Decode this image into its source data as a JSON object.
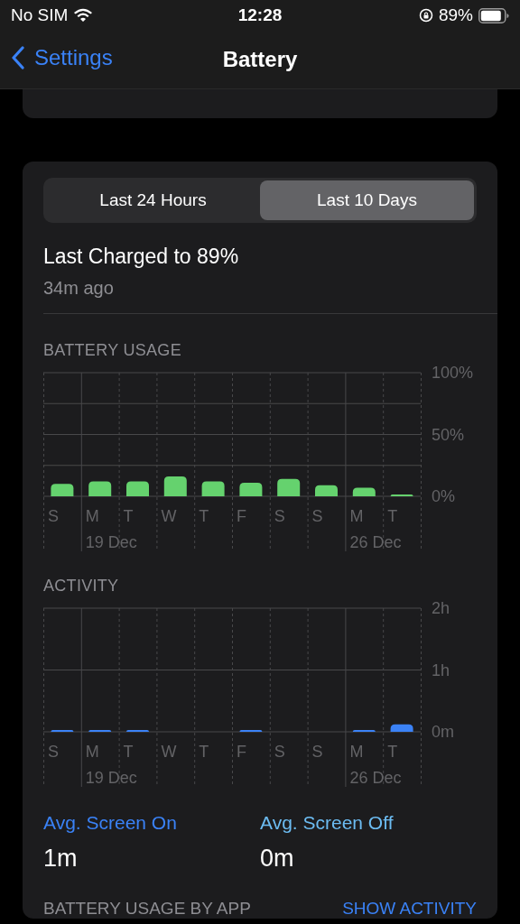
{
  "status_bar": {
    "carrier": "No SIM",
    "time": "12:28",
    "battery_percent": "89%"
  },
  "nav": {
    "back": "Settings",
    "title": "Battery"
  },
  "tabs": [
    {
      "label": "Last 24 Hours",
      "selected": false
    },
    {
      "label": "Last 10 Days",
      "selected": true
    }
  ],
  "last_charged": {
    "title": "Last Charged to 89%",
    "subtitle": "34m ago"
  },
  "charts": [
    {
      "date_labels": [
        "19 Dec",
        "26 Dec"
      ],
      "chart_data": {
        "type": "bar",
        "categories": [
          "S",
          "M",
          "T",
          "W",
          "T",
          "F",
          "S",
          "S",
          "M",
          "T"
        ],
        "series": [
          {
            "name": "BATTERY USAGE",
            "color": "#65d26e",
            "values": [
              10,
              12,
              12,
              16,
              12,
              11,
              14,
              9,
              7,
              1
            ]
          }
        ],
        "ylim": [
          0,
          100
        ],
        "yticks": [
          {
            "value": 0,
            "label": "0%"
          },
          {
            "value": 50,
            "label": "50%"
          },
          {
            "value": 100,
            "label": "100%"
          }
        ]
      }
    },
    {
      "date_labels": [
        "19 Dec",
        "26 Dec"
      ],
      "chart_data": {
        "type": "bar",
        "categories": [
          "S",
          "M",
          "T",
          "W",
          "T",
          "F",
          "S",
          "S",
          "M",
          "T"
        ],
        "series": [
          {
            "name": "ACTIVITY",
            "color": "#3b82f6",
            "values": [
              0.03,
              0.02,
              0.02,
              0,
              0,
              0.02,
              0,
              0,
              0.02,
              0.12
            ]
          }
        ],
        "ylim": [
          0,
          2
        ],
        "yticks": [
          {
            "value": 0,
            "label": "0m"
          },
          {
            "value": 1,
            "label": "1h"
          },
          {
            "value": 2,
            "label": "2h"
          }
        ]
      }
    }
  ],
  "averages": [
    {
      "label": "Avg. Screen On",
      "value": "1m",
      "color": "#3a82f7"
    },
    {
      "label": "Avg. Screen Off",
      "value": "0m",
      "color": "#6cbcf2"
    }
  ],
  "footer": {
    "heading": "BATTERY USAGE BY APP",
    "action": "SHOW ACTIVITY"
  }
}
